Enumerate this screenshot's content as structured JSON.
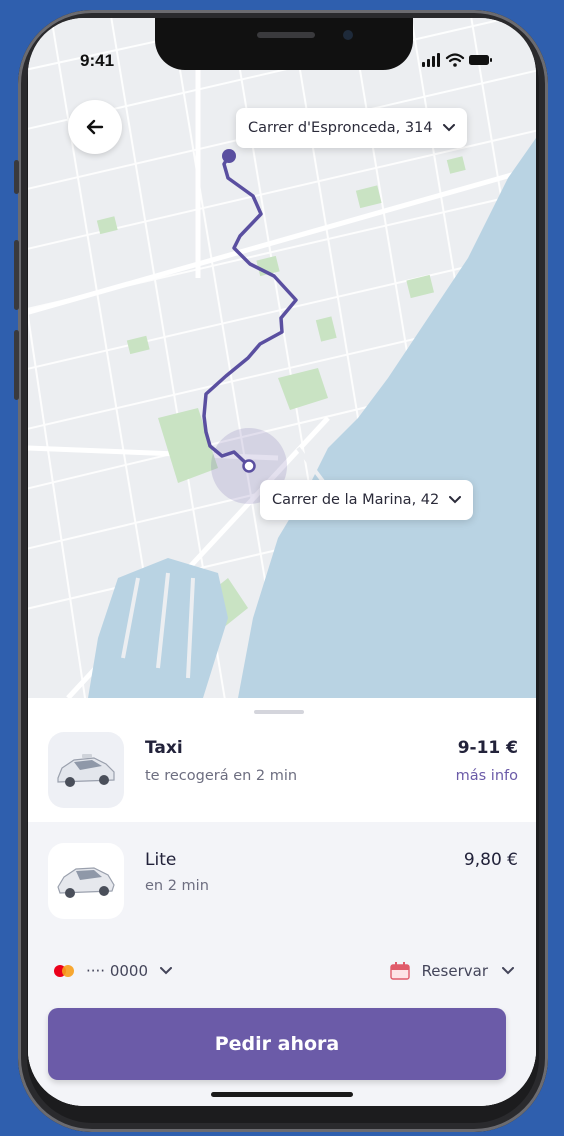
{
  "status_bar": {
    "time": "9:41"
  },
  "map": {
    "origin_address": "Carrer d'Espronceda, 314",
    "destination_address": "Carrer de la Marina, 42"
  },
  "rides": [
    {
      "name": "Taxi",
      "eta": "te recogerá en 2 min",
      "price": "9-11 €",
      "link": "más info",
      "selected": true
    },
    {
      "name": "Lite",
      "eta": "en 2 min",
      "price": "9,80 €",
      "selected": false
    }
  ],
  "payment": {
    "card_masked": "···· 0000",
    "reserve_label": "Reservar"
  },
  "cta": {
    "label": "Pedir ahora"
  },
  "colors": {
    "accent": "#6b5ba8",
    "route": "#5a4fa0",
    "water": "#b9d3e3",
    "park": "#c9e3c3"
  },
  "icons": [
    "back-arrow-icon",
    "chevron-down-icon",
    "mastercard-icon",
    "calendar-icon",
    "signal-icon",
    "wifi-icon",
    "battery-icon",
    "car-icon"
  ]
}
